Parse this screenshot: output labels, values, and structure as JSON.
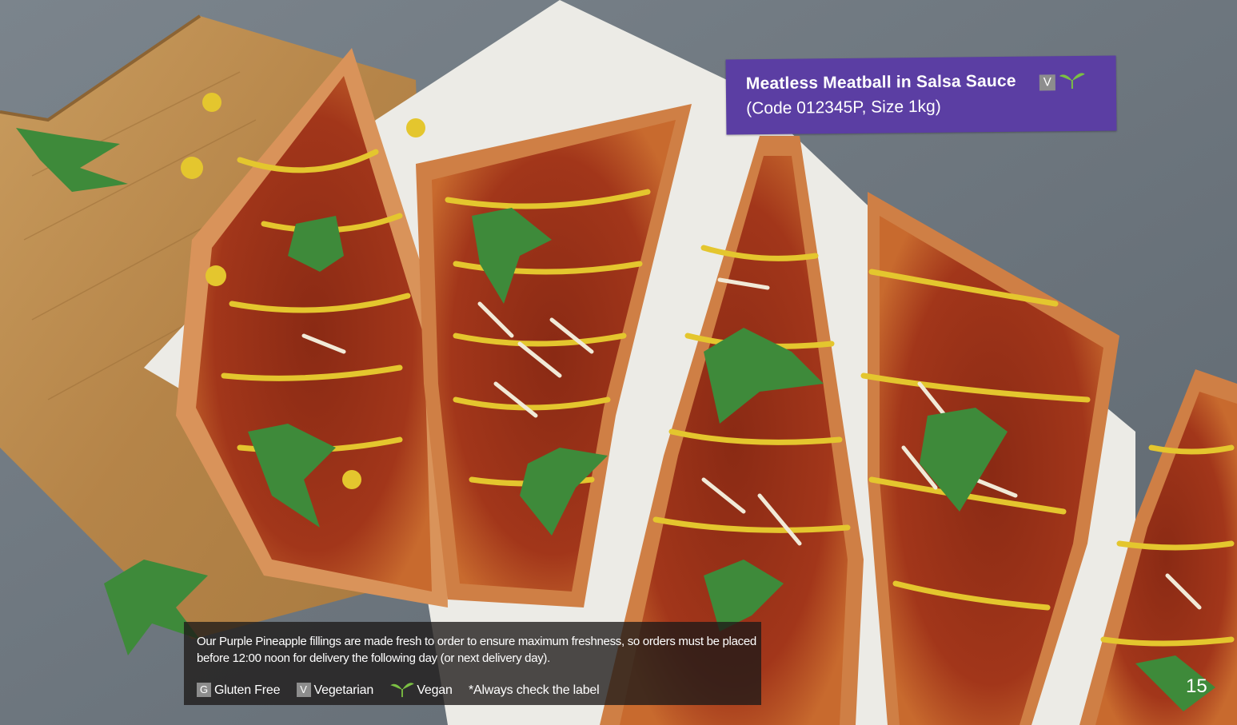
{
  "product": {
    "name": "Meatless Meatball in Salsa Sauce",
    "details": "(Code 012345P, Size 1kg)",
    "badges": {
      "vegetarian_letter": "V",
      "vegan_icon": "leaf-sprout-icon"
    }
  },
  "footer": {
    "description": "Our Purple Pineapple fillings are made fresh to order to ensure maximum freshness, so orders must be placed before 12:00 noon for delivery the following day (or next delivery day).",
    "legend": {
      "gluten_free_letter": "G",
      "gluten_free_label": "Gluten Free",
      "vegetarian_letter": "V",
      "vegetarian_label": "Vegetarian",
      "vegan_icon": "leaf-sprout-icon",
      "vegan_label": "Vegan",
      "note": "*Always check the label"
    }
  },
  "page_number": "15",
  "colors": {
    "banner": "#5b3ea3",
    "badge_gray": "#8d8d8d",
    "leaf_green": "#7bc043"
  }
}
